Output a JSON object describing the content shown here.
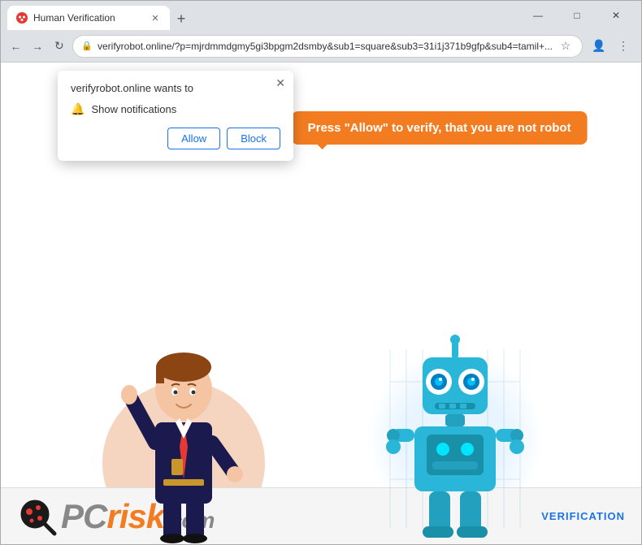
{
  "window": {
    "title": "Human Verification",
    "tab_favicon": "🔴",
    "new_tab_label": "+",
    "controls": {
      "minimize": "—",
      "maximize": "□",
      "close": "✕"
    }
  },
  "nav": {
    "back_label": "←",
    "forward_label": "→",
    "refresh_label": "↻",
    "address": "verifyrobot.online/?p=mjrdmmdgmy5gi3bpgm2dsmby&sub1=square&sub3=31i1j371b9gfp&sub4=tamil+...",
    "lock_icon": "🔒",
    "star_icon": "☆",
    "profile_icon": "👤",
    "menu_icon": "⋮"
  },
  "popup": {
    "title": "verifyrobot.online wants to",
    "close_icon": "✕",
    "notification_icon": "🔔",
    "notification_text": "Show notifications",
    "allow_label": "Allow",
    "block_label": "Block"
  },
  "page": {
    "speech_bubble_text": "Press \"Allow\" to verify, that you are not robot",
    "speech_bubble_color": "#f47c20"
  },
  "footer": {
    "pc_text": "PC",
    "risk_text": "risk",
    "com_text": ".com",
    "verification_text": "VERIFICATION"
  }
}
